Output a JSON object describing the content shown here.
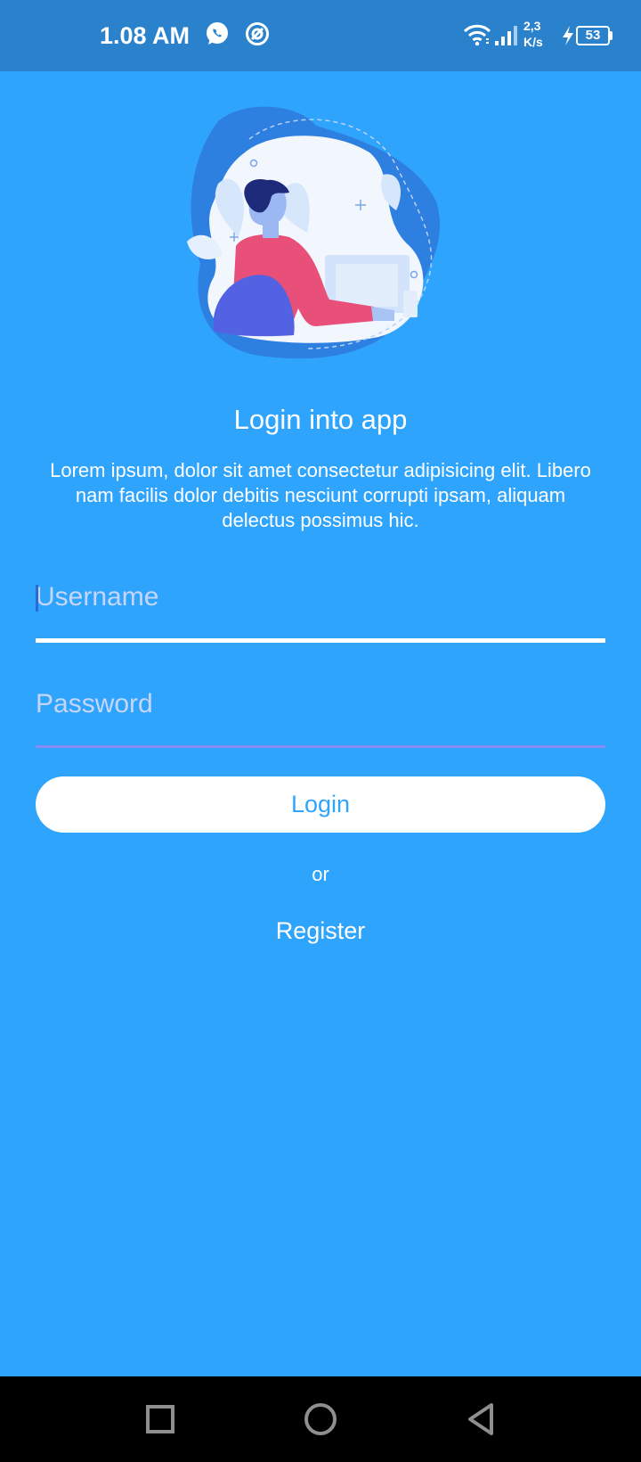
{
  "status_bar": {
    "time": "1.08 AM",
    "net_speed_value": "2,3",
    "net_speed_unit": "K/s",
    "battery_level": "53",
    "icons": [
      "whatsapp-icon",
      "sync-icon",
      "wifi-icon",
      "signal-icon",
      "charging-icon",
      "battery-icon"
    ]
  },
  "login": {
    "title": "Login into app",
    "description": "Lorem ipsum, dolor sit amet consectetur adipisicing elit. Libero nam facilis dolor debitis nesciunt corrupti ipsam, aliquam delectus possimus hic.",
    "username_placeholder": "Username",
    "username_value": "",
    "password_placeholder": "Password",
    "password_value": "",
    "login_button": "Login",
    "or_text": "or",
    "register_link": "Register"
  },
  "nav_bar": {
    "icons": [
      "recent-apps-icon",
      "home-icon",
      "back-icon"
    ]
  },
  "colors": {
    "background": "#2fa4fd",
    "status_bar": "#2a82cc",
    "button_bg": "#ffffff",
    "button_text": "#2fa4fd",
    "password_underline": "#8a8bf2",
    "nav_bar": "#000000"
  }
}
